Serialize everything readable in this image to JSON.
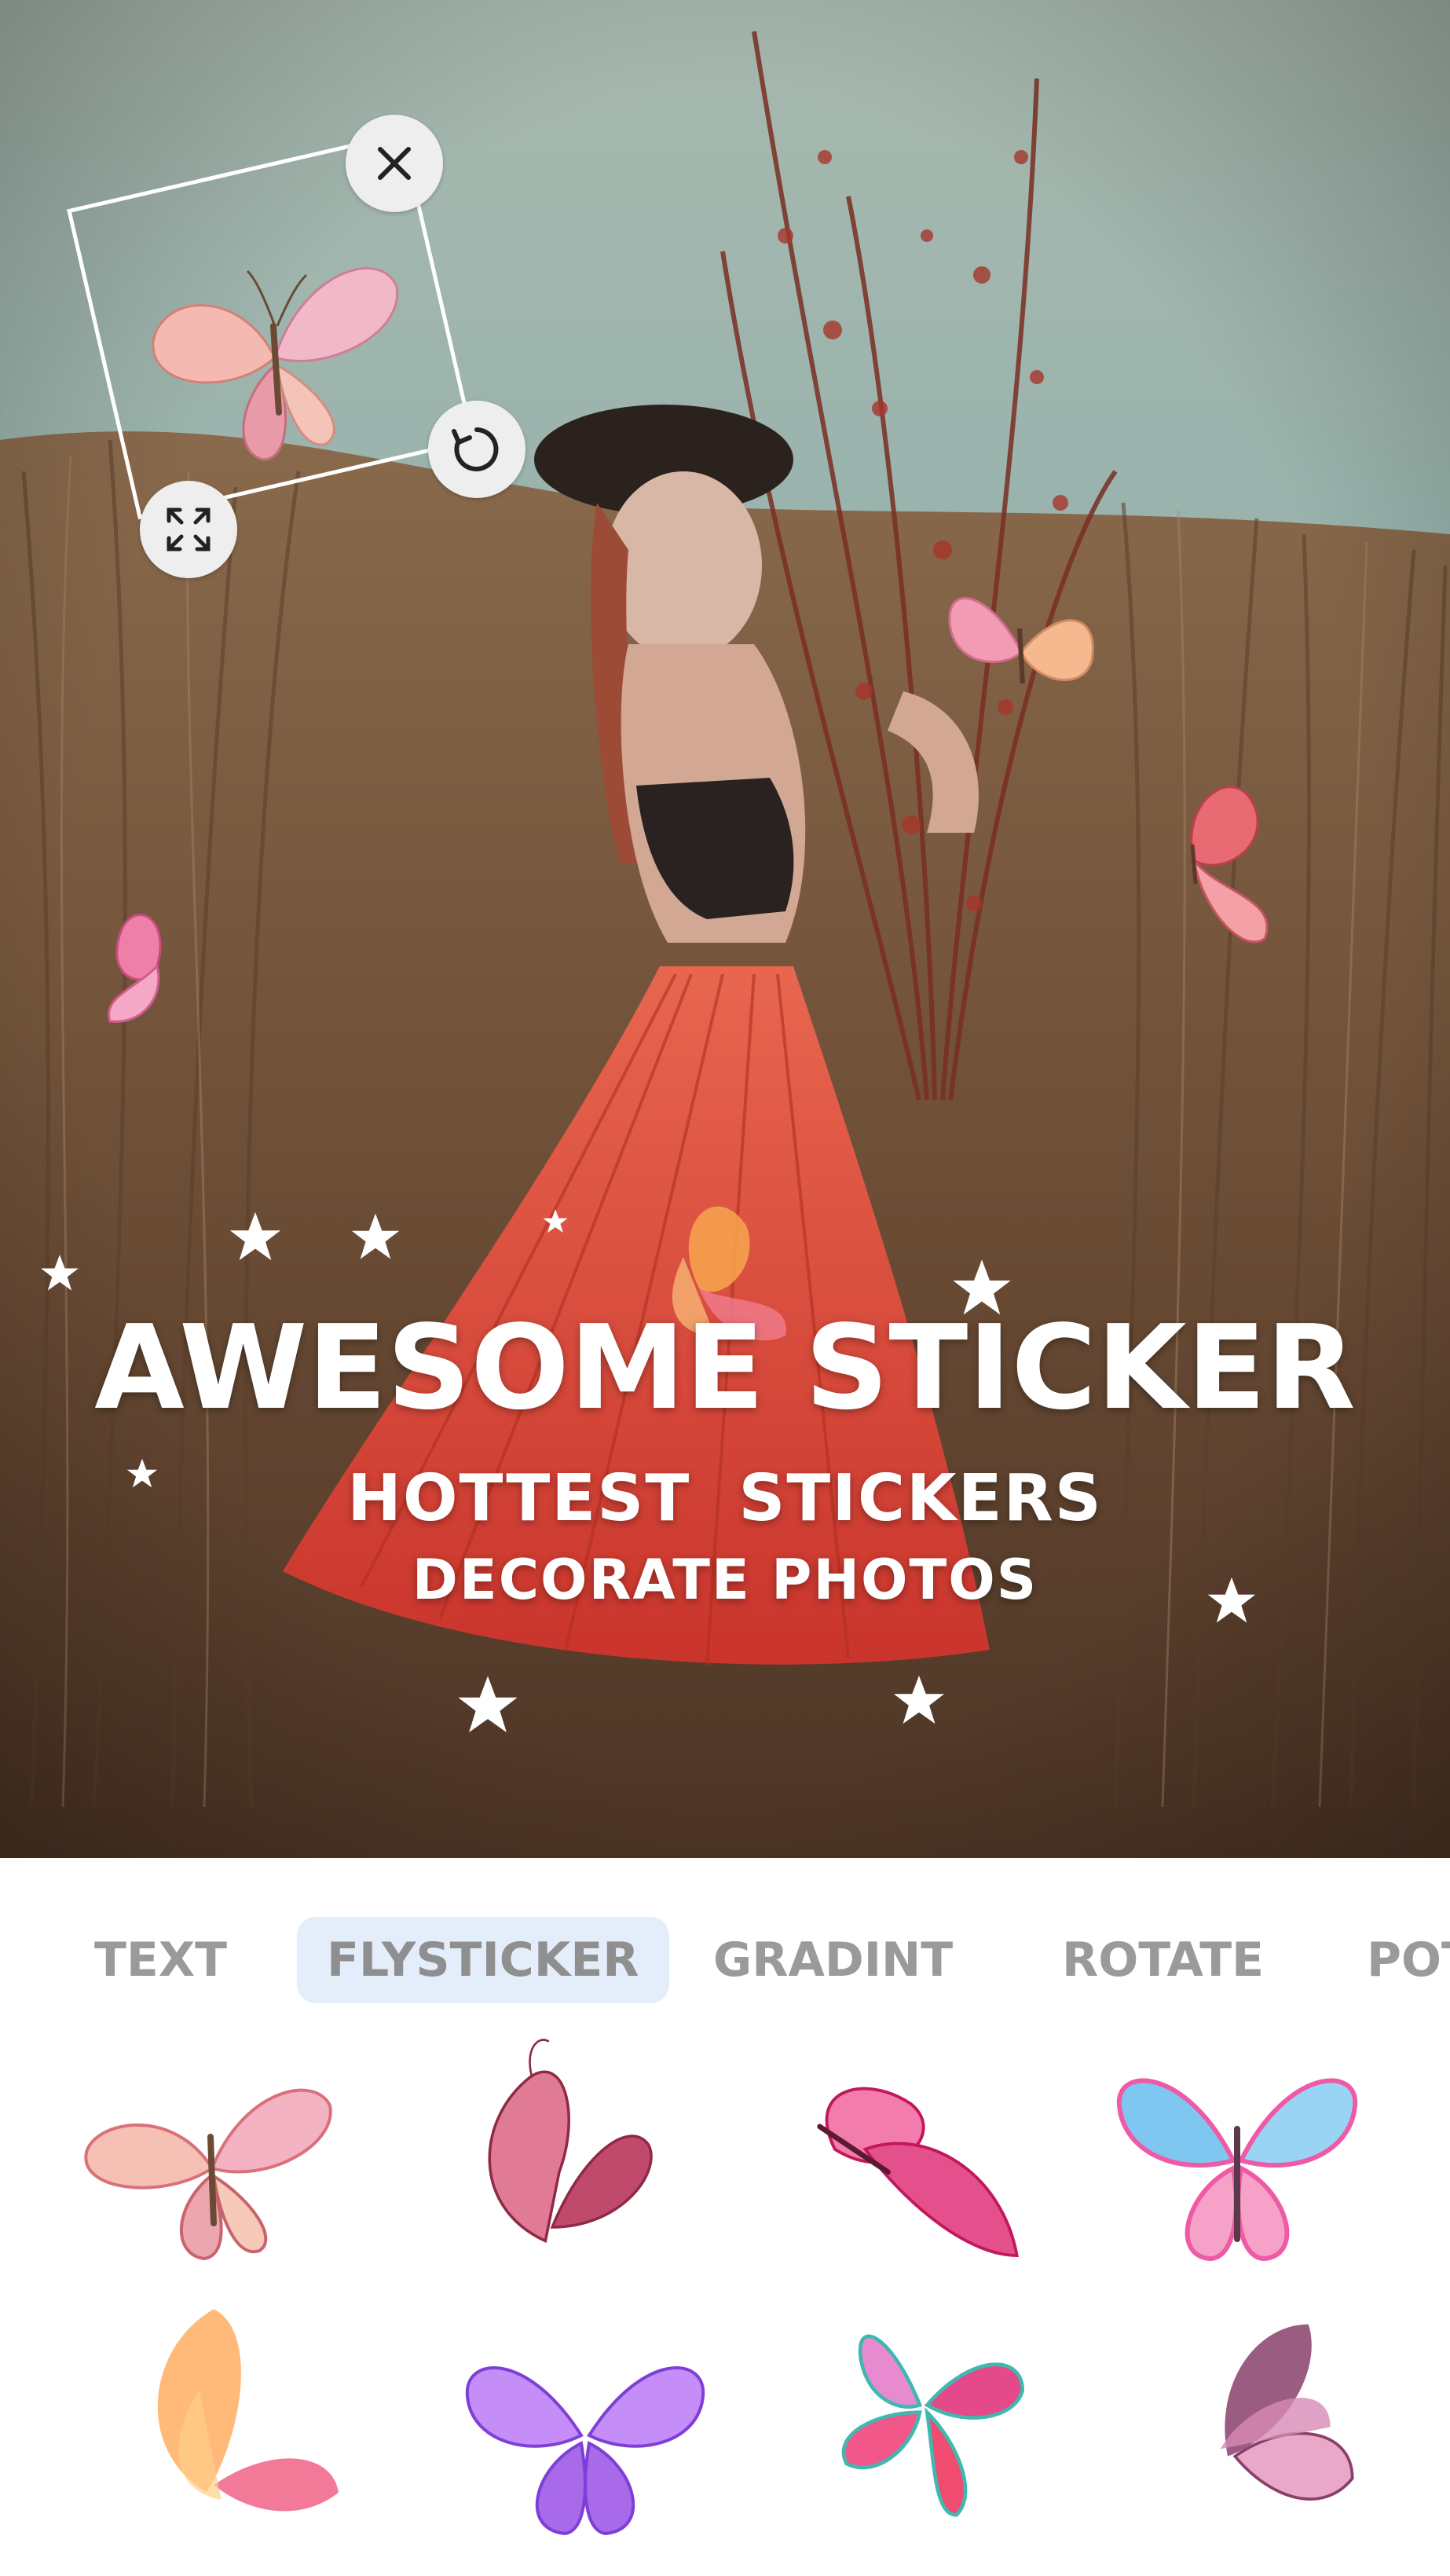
{
  "canvas": {
    "headline": "AWESOME STICKER",
    "subheadline": "HOTTEST  STICKERS",
    "tagline": "DECORATE PHOTOS"
  },
  "selection": {
    "close_icon": "close-icon",
    "rotate_icon": "rotate-icon",
    "resize_icon": "resize-icon"
  },
  "tabs": [
    {
      "label": "TEXT",
      "active": false
    },
    {
      "label": "FLYSTICKER",
      "active": true
    },
    {
      "label": "GRADINT",
      "active": false
    },
    {
      "label": "ROTATE",
      "active": false
    },
    {
      "label": "POT",
      "active": false
    }
  ],
  "sticker_grid": [
    {
      "name": "peach-butterfly",
      "colors": [
        "#f6c0b5",
        "#d9707a"
      ]
    },
    {
      "name": "rose-butterfly-side",
      "colors": [
        "#e07a95",
        "#8e2a45"
      ]
    },
    {
      "name": "magenta-butterfly-side",
      "colors": [
        "#f27cab",
        "#c2185b"
      ]
    },
    {
      "name": "rainbow-butterfly",
      "colors": [
        "#7fc7f0",
        "#ef5aa6"
      ]
    },
    {
      "name": "orange-butterfly-side",
      "colors": [
        "#ffb36b",
        "#f26a8d"
      ]
    },
    {
      "name": "violet-butterfly",
      "colors": [
        "#c48df7",
        "#7e3fd6"
      ]
    },
    {
      "name": "teal-pink-butterfly",
      "colors": [
        "#e44a8a",
        "#3fb8b0"
      ]
    },
    {
      "name": "mauve-butterfly-side",
      "colors": [
        "#e9a8c8",
        "#8a3f6b"
      ]
    }
  ],
  "colors": {
    "accent_tab_bg": "#e4eefb",
    "tab_text": "#9a9a9a",
    "sky": "#8fb1ad",
    "grass": "#7a5a3e",
    "skirt": "#e0533f"
  }
}
